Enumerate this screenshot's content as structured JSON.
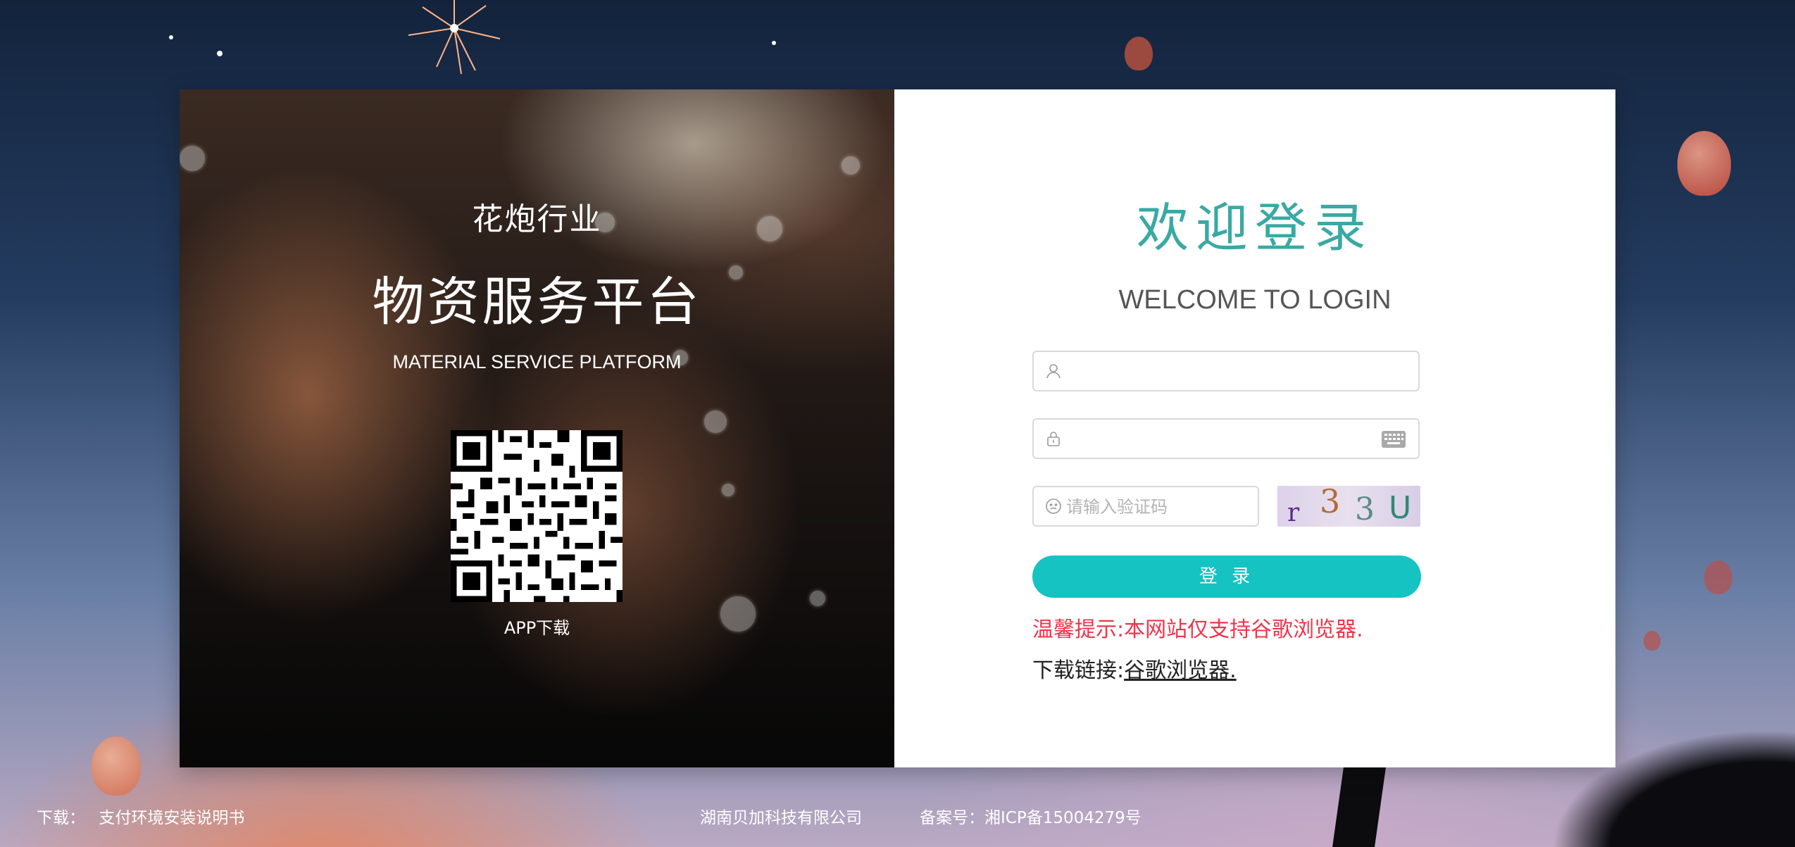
{
  "brand": {
    "industry": "花炮行业",
    "platform_name": "物资服务平台",
    "platform_name_en": "MATERIAL SERVICE PLATFORM",
    "app_download_label": "APP下载"
  },
  "login": {
    "welcome_cn": "欢迎登录",
    "welcome_en": "WELCOME TO LOGIN",
    "username": {
      "value": "",
      "placeholder": ""
    },
    "password": {
      "value": "",
      "placeholder": ""
    },
    "captcha": {
      "value": "",
      "placeholder": "请输入验证码",
      "image_text": [
        "r",
        "3",
        "3",
        "U"
      ]
    },
    "submit_label": "登 录",
    "tip": "温馨提示:本网站仅支持谷歌浏览器.",
    "download_prefix": "下载链接:",
    "download_link_text": "谷歌浏览器."
  },
  "footer": {
    "download_label": "下载：",
    "manual_link": "支付环境安装说明书",
    "company": "湖南贝加科技有限公司",
    "icp": "备案号：湘ICP备15004279号"
  },
  "icons": {
    "username": "user-icon",
    "password": "lock-icon",
    "keyboard": "keyboard-icon",
    "captcha": "smiley-icon"
  },
  "colors": {
    "accent": "#14c3c2",
    "title_teal": "#3aa9a3",
    "tip_red": "#f0344a"
  }
}
